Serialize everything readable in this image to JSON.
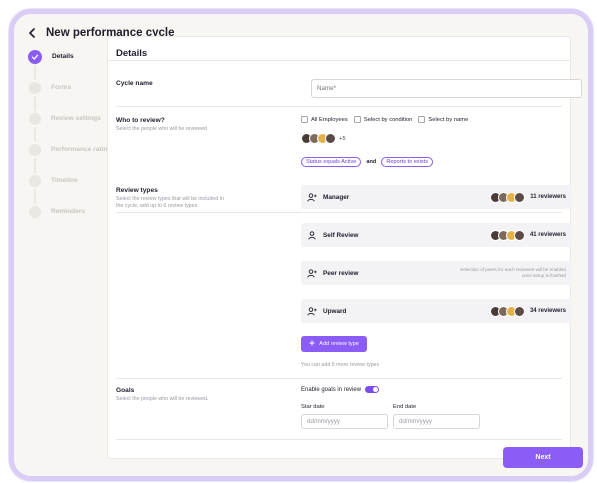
{
  "header": {
    "title": "New performance cycle"
  },
  "stepper": {
    "steps": [
      {
        "label": "Details",
        "active": true
      },
      {
        "label": "Forms",
        "active": false
      },
      {
        "label": "Review settings",
        "active": false
      },
      {
        "label": "Performance rating",
        "active": false
      },
      {
        "label": "Timeline",
        "active": false
      },
      {
        "label": "Reminders",
        "active": false
      }
    ]
  },
  "details": {
    "title": "Details",
    "cycle_name": {
      "label": "Cycle name",
      "placeholder": "Name*"
    },
    "who": {
      "label": "Who to review?",
      "description": "Select the people who will be reviewed",
      "options": [
        "All Employees",
        "Select by condition",
        "Select by name"
      ],
      "extra_count": "+5",
      "chips": [
        "Status equals Active",
        "Reports to exists"
      ],
      "connector": "and"
    },
    "review_types": {
      "label": "Review types",
      "description": "Select the review types that will be included in the cycle, add up to 6 review types.",
      "items": [
        {
          "label": "Manager",
          "count": "11 reviewers"
        },
        {
          "label": "Self Review",
          "count": "41 reviewers"
        },
        {
          "label": "Peer review",
          "note": "Selection of peers for each reviewee will be enabled once setup is finished"
        },
        {
          "label": "Upward",
          "count": "34 reviewers"
        }
      ],
      "add_label": "Add review type",
      "hint": "You can add 5 more review types"
    },
    "goals": {
      "label": "Goals",
      "description": "Select the people who will be reviewed.",
      "toggle_label": "Enable goals in review",
      "start_label": "Star date",
      "end_label": "End date",
      "date_placeholder": "dd/mm/yyyy"
    }
  },
  "footer": {
    "next_label": "Next"
  },
  "colors": {
    "accent": "#8b5cf6",
    "frame": "#d9cdf6"
  }
}
